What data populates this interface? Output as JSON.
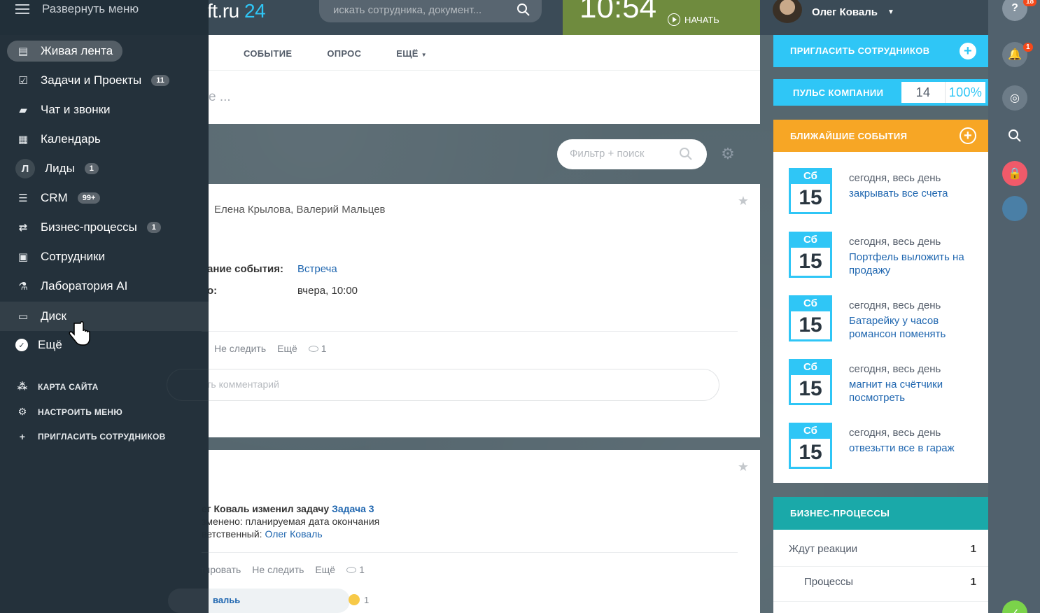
{
  "header": {
    "logo_text": "ft.ru",
    "logo_num": "24",
    "search_placeholder": "искать сотрудника, документ...",
    "clock_time": "10:54",
    "clock_start": "НАЧАТЬ",
    "user_name": "Олег Коваль"
  },
  "feed": {
    "tabs": [
      "СОБЫТИЕ",
      "ОПРОС",
      "ЕЩЁ"
    ],
    "compose_placeholder": "е ...",
    "filter_placeholder": "Фильтр + поиск",
    "post1": {
      "people": "Елена Крылова, Валерий Мальцев",
      "event_name_label": "ание события:",
      "event_name_value": "Встреча",
      "start_label": "о:",
      "start_value": "вчера, 10:00",
      "actions": {
        "unfollow": "Не следить",
        "more": "Ещё",
        "views": "1"
      },
      "comment_placeholder": "ть комментарий"
    },
    "post2": {
      "line1_prefix": "ег Коваль изменил задачу",
      "line1_link": "Задача 3",
      "line2": "зменено: планируемая дата окончания",
      "line3_prefix": "ветственный:",
      "line3_link": "Олег Коваль",
      "actions": {
        "comment": "тировать",
        "unfollow": "Не следить",
        "more": "Ещё",
        "views": "1"
      },
      "footer_name": "вальь",
      "footer_reaction": "1"
    }
  },
  "right": {
    "invite": "ПРИГЛАСИТЬ СОТРУДНИКОВ",
    "pulse_label": "ПУЛЬС КОМПАНИИ",
    "pulse_value": "14",
    "pulse_percent": "100%",
    "events_title": "БЛИЖАЙШИЕ СОБЫТИЯ",
    "events": [
      {
        "dow": "Сб",
        "day": "15",
        "when": "сегодня, весь день",
        "title": "закрывать все счета"
      },
      {
        "dow": "Сб",
        "day": "15",
        "when": "сегодня, весь день",
        "title": "Портфель выложить на продажу"
      },
      {
        "dow": "Сб",
        "day": "15",
        "when": "сегодня, весь день",
        "title": "Батарейку у часов романсон поменять"
      },
      {
        "dow": "Сб",
        "day": "15",
        "when": "сегодня, весь день",
        "title": "магнит на счётчики посмотреть"
      },
      {
        "dow": "Сб",
        "day": "15",
        "when": "сегодня, весь день",
        "title": "отвезьтти все в гараж"
      }
    ],
    "bp_title": "БИЗНЕС-ПРОЦЕССЫ",
    "bp_rows": [
      {
        "label": "Ждут реакции",
        "count": "1"
      },
      {
        "label": "Процессы",
        "count": "1"
      }
    ]
  },
  "rail": {
    "notif_badge": "1",
    "help_badge": "18"
  },
  "menu": {
    "expand": "Развернуть меню",
    "items": [
      {
        "label": "Живая лента",
        "icon": "feed-icon",
        "badge": ""
      },
      {
        "label": "Задачи и Проекты",
        "icon": "tasks-icon",
        "badge": "11"
      },
      {
        "label": "Чат и звонки",
        "icon": "chat-icon",
        "badge": ""
      },
      {
        "label": "Календарь",
        "icon": "calendar-icon",
        "badge": ""
      },
      {
        "label": "Лиды",
        "icon": "leads-icon",
        "badge": "1"
      },
      {
        "label": "CRM",
        "icon": "crm-icon",
        "badge": "99+"
      },
      {
        "label": "Бизнес-процессы",
        "icon": "bizproc-icon",
        "badge": "1"
      },
      {
        "label": "Сотрудники",
        "icon": "employees-icon",
        "badge": ""
      },
      {
        "label": "Лаборатория AI",
        "icon": "lab-icon",
        "badge": ""
      },
      {
        "label": "Диск",
        "icon": "disk-icon",
        "badge": ""
      },
      {
        "label": "Ещё",
        "icon": "more-icon",
        "badge": ""
      }
    ],
    "sitemap": "КАРТА САЙТА",
    "configure": "НАСТРОИТЬ МЕНЮ",
    "invite": "ПРИГЛАСИТЬ СОТРУДНИКОВ"
  }
}
